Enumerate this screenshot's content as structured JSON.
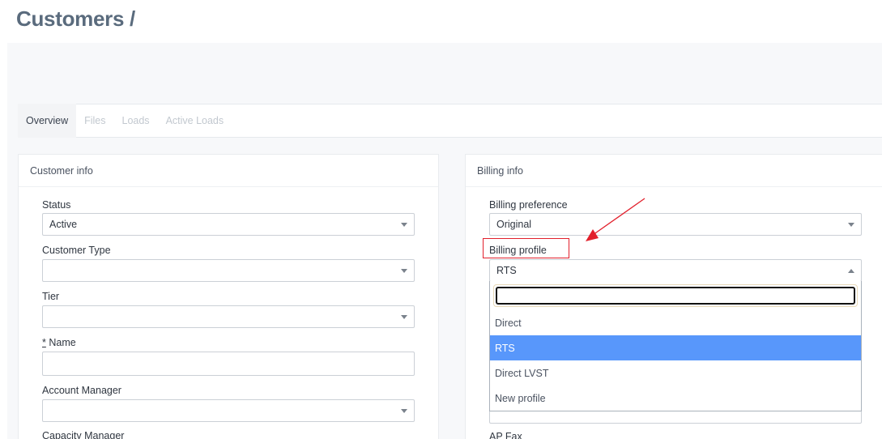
{
  "page": {
    "title": "Customers /"
  },
  "tabs": [
    {
      "label": "Overview",
      "active": true
    },
    {
      "label": "Files",
      "active": false
    },
    {
      "label": "Loads",
      "active": false
    },
    {
      "label": "Active Loads",
      "active": false
    }
  ],
  "customer_info": {
    "heading": "Customer info",
    "status": {
      "label": "Status",
      "value": "Active"
    },
    "customer_type": {
      "label": "Customer Type",
      "value": ""
    },
    "tier": {
      "label": "Tier",
      "value": ""
    },
    "name": {
      "required_mark": "*",
      "label": "Name",
      "value": ""
    },
    "account_manager": {
      "label": "Account Manager",
      "value": ""
    },
    "capacity_manager": {
      "label": "Capacity Manager"
    }
  },
  "billing_info": {
    "heading": "Billing info",
    "billing_preference": {
      "label": "Billing preference",
      "value": "Original"
    },
    "billing_profile": {
      "label": "Billing profile",
      "value": "RTS",
      "options": [
        "Direct",
        "RTS",
        "Direct LVST",
        "New profile"
      ],
      "selected_option": "RTS"
    },
    "ap_fax": {
      "label": "AP Fax"
    }
  },
  "colors": {
    "selected_option": "#5897fb",
    "annotation": "#e2202c",
    "title": "#5a6b7d"
  }
}
